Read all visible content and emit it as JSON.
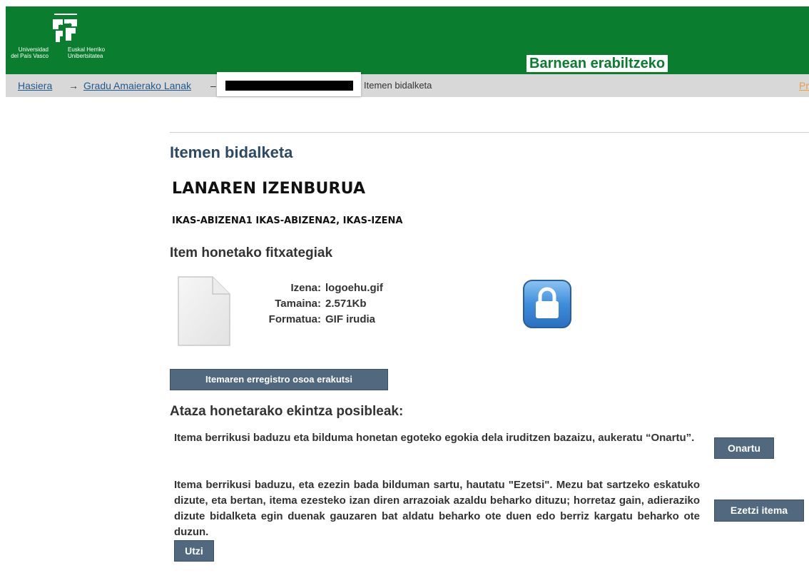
{
  "header": {
    "logo_text_es": "Universidad\ndel País Vasco",
    "logo_text_eu": "Euskal Herriko\nUnibertsitatea",
    "badge": "Barnean erabiltzeko",
    "brand_color": "#0b7d2e"
  },
  "breadcrumb": {
    "home": "Hasiera",
    "arrow": "→",
    "section": "Gradu Amaierako Lanak",
    "dash": "–",
    "current": "Itemen bidalketa",
    "profile": "Profi"
  },
  "page": {
    "title": "Itemen bidalketa",
    "item_title": "LANAREN IZENBURUA",
    "item_authors": "IKAS-ABIZENA1 IKAS-ABIZENA2, IKAS-IZENA",
    "files_heading": "Item honetako fitxategiak"
  },
  "file": {
    "name_label": "Izena:",
    "name_value": "logoehu.gif",
    "size_label": "Tamaina:",
    "size_value": "2.571Kb",
    "format_label": "Formatua:",
    "format_value": "GIF irudia",
    "icon": "document-icon",
    "access_icon": "lock-icon"
  },
  "buttons": {
    "show_full": "Itemaren erregistro osoa erakutsi",
    "accept": "Onartu",
    "reject": "Ezetzi itema",
    "cancel": "Utzi"
  },
  "actions": {
    "heading": "Ataza honetarako ekintza posibleak:",
    "accept_text": "Itema berrikusi baduzu eta bilduma honetan egoteko egokia dela iruditzen bazaizu, aukeratu “Onartu”.",
    "reject_text": "Itema berrikusi baduzu, eta ezezin bada bilduman sartu, hautatu \"Ezetsi\". Mezu bat sartzeko eskatuko dizute, eta bertan, itema ezesteko izan diren arrazoiak azaldu beharko dituzu; horretaz gain, adieraziko dizute bidalketa egin duenak gauzaren bat aldatu beharko ote duen edo berriz kargatu beharko ote duzun."
  }
}
